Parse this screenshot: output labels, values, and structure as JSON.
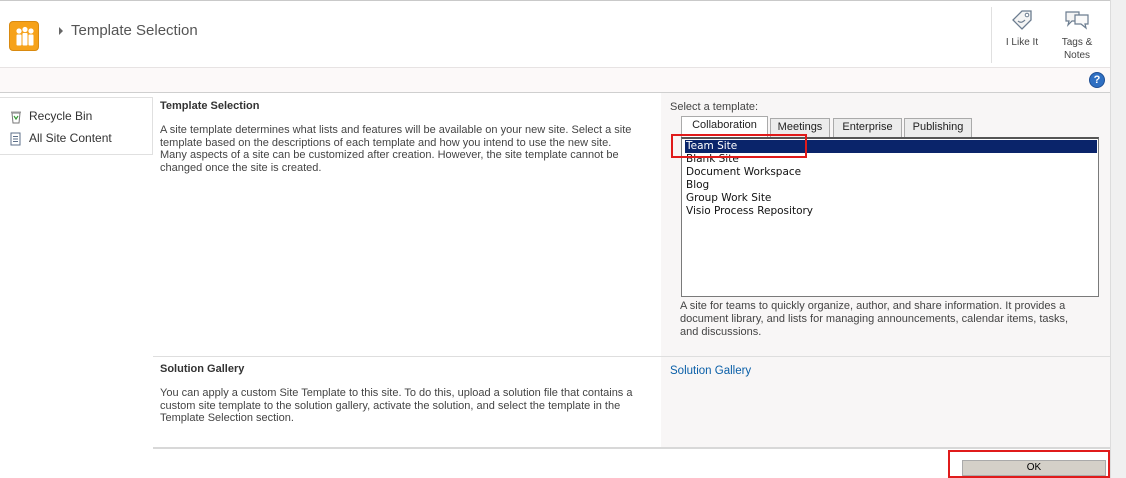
{
  "header": {
    "title": "Template Selection",
    "social": [
      {
        "label": "I Like It",
        "icon": "tag-icon"
      },
      {
        "label_line1": "Tags &",
        "label_line2": "Notes",
        "icon": "notes-icon"
      }
    ],
    "help_icon": "help-icon",
    "help_glyph": "?"
  },
  "quick_launch": {
    "items": [
      {
        "label": "Recycle Bin",
        "icon": "recycle-bin-icon"
      },
      {
        "label": "All Site Content",
        "icon": "all-site-content-icon"
      }
    ]
  },
  "template_section": {
    "title": "Template Selection",
    "description": "A site template determines what lists and features will be available on your new site. Select a site template based on the descriptions of each template and how you intend to use the new site. Many aspects of a site can be customized after creation. However, the site template cannot be changed once the site is created.",
    "select_label": "Select a template:",
    "tabs": [
      "Collaboration",
      "Meetings",
      "Enterprise",
      "Publishing"
    ],
    "active_tab": "Collaboration",
    "templates": [
      "Team Site",
      "Blank Site",
      "Document Workspace",
      "Blog",
      "Group Work Site",
      "Visio Process Repository"
    ],
    "selected_template": "Team Site",
    "template_description": "A site for teams to quickly organize, author, and share information. It provides a document library, and lists for managing announcements, calendar items, tasks, and discussions."
  },
  "solution_section": {
    "title": "Solution Gallery",
    "description": "You can apply a custom Site Template to this site. To do this, upload a solution file that contains a custom site template to the solution gallery, activate the solution, and select the template in the Template Selection section.",
    "link": "Solution Gallery"
  },
  "footer": {
    "ok_label": "OK"
  },
  "colors": {
    "accent_link": "#0a5fa8",
    "selection": "#0a246a",
    "highlight": "#e01b1b",
    "logo": "#f6a21a"
  }
}
